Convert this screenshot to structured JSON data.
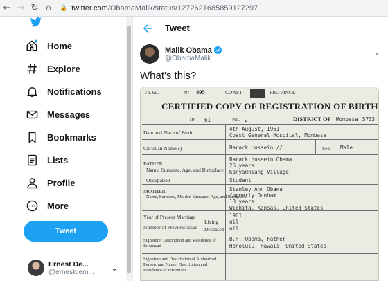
{
  "browser": {
    "url_host": "twitter.com",
    "url_path": "/ObamaMalik/status/1272621685859127297"
  },
  "sidebar": {
    "items": [
      {
        "label": "Home",
        "icon": "home-icon"
      },
      {
        "label": "Explore",
        "icon": "hashtag-icon"
      },
      {
        "label": "Notifications",
        "icon": "bell-icon"
      },
      {
        "label": "Messages",
        "icon": "envelope-icon"
      },
      {
        "label": "Bookmarks",
        "icon": "bookmark-icon"
      },
      {
        "label": "Lists",
        "icon": "list-icon"
      },
      {
        "label": "Profile",
        "icon": "person-icon"
      },
      {
        "label": "More",
        "icon": "more-circle-icon"
      }
    ],
    "tweet_button": "Tweet",
    "account": {
      "name": "Ernest De...",
      "handle": "@ernestdem..."
    }
  },
  "header": {
    "title": "Tweet"
  },
  "tweet": {
    "author_name": "Malik Obama",
    "author_handle": "@ObamaMalik",
    "text": "What's this?"
  },
  "certificate": {
    "top_left": "7a. 6d.",
    "number_label": "N°",
    "number": "495",
    "coast": "COAST",
    "province": "PROVINCE",
    "title": "CERTIFIED COPY OF REGISTRATION OF BIRTH",
    "year_prefix": "19",
    "year_suffix": "61",
    "no_label": "No.",
    "no_value": "2",
    "district_label": "DISTRICT OF",
    "district_value": "Mombasa",
    "district_code": "5733",
    "rows": [
      {
        "label": "Date and Place of Birth",
        "lines": [
          "4th August, 1961",
          "Coast General Hospital, Mombasa"
        ]
      },
      {
        "label": "Christian Name(s)",
        "lines": [
          "Barack Hussein //"
        ]
      },
      {
        "label": "FATHER",
        "lines": [
          "Barack Hussein Obama",
          "26 years",
          "Kanyadhiang Village"
        ]
      },
      {
        "label": "Name, Surname, Age, and Birthplace",
        "lines": []
      },
      {
        "label": "Occupation",
        "lines": [
          "Student"
        ]
      },
      {
        "label": "MOTHER—",
        "lines": [
          "Stanley Ann Obama",
          "formerly Dunham",
          "18 years",
          "Wichita, Kansas, United States"
        ]
      },
      {
        "label": "Name, Surname, Maiden Surname, Age, and Birthplace",
        "lines": []
      },
      {
        "label": "Year of Present Marriage",
        "lines": [
          "1961"
        ]
      },
      {
        "label": "Number of Previous Issue",
        "lines": [
          "nil",
          "nil"
        ]
      },
      {
        "label": "Signature, Description and Residence of Informant",
        "lines": [
          "B.H. Obama, Father",
          "Honolulu, Hawaii, United States"
        ]
      },
      {
        "label": "Signature and Description of Authorized Person, and Name, Description and Residence of Informant",
        "lines": []
      }
    ],
    "sex_label": "Sex",
    "sex_value": "Male",
    "living_label": "Living",
    "deceased_label": "Deceased"
  },
  "colors": {
    "brand": "#1da1f2",
    "text": "#14171a",
    "muted": "#657786"
  }
}
